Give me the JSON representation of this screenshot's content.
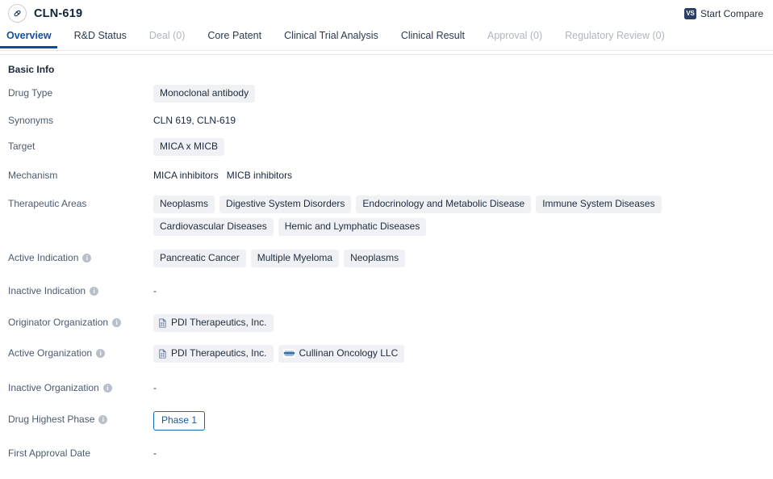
{
  "header": {
    "drug_icon": "pill-capsule-icon",
    "title": "CLN-619",
    "compare_icon_text": "VS",
    "compare_label": "Start Compare"
  },
  "tabs": [
    {
      "label": "Overview",
      "state": "active"
    },
    {
      "label": "R&D Status",
      "state": "normal"
    },
    {
      "label": "Deal (0)",
      "state": "disabled"
    },
    {
      "label": "Core Patent",
      "state": "normal"
    },
    {
      "label": "Clinical Trial Analysis",
      "state": "normal"
    },
    {
      "label": "Clinical Result",
      "state": "normal"
    },
    {
      "label": "Approval (0)",
      "state": "disabled"
    },
    {
      "label": "Regulatory Review (0)",
      "state": "disabled"
    }
  ],
  "section": {
    "title": "Basic Info"
  },
  "rows": {
    "drug_type": {
      "label": "Drug Type",
      "tags": [
        "Monoclonal antibody"
      ]
    },
    "synonyms": {
      "label": "Synonyms",
      "text": "CLN 619,  CLN-619"
    },
    "target": {
      "label": "Target",
      "tags": [
        "MICA x MICB"
      ]
    },
    "mechanism": {
      "label": "Mechanism",
      "items": [
        "MICA inhibitors",
        "MICB inhibitors"
      ]
    },
    "therapeutic_areas": {
      "label": "Therapeutic Areas",
      "tags": [
        "Neoplasms",
        "Digestive System Disorders",
        "Endocrinology and Metabolic Disease",
        "Immune System Diseases",
        "Cardiovascular Diseases",
        "Hemic and Lymphatic Diseases"
      ]
    },
    "active_indication": {
      "label": "Active Indication",
      "has_info": true,
      "tags": [
        "Pancreatic Cancer",
        "Multiple Myeloma",
        "Neoplasms"
      ]
    },
    "inactive_indication": {
      "label": "Inactive Indication",
      "has_info": true,
      "value": "-"
    },
    "originator_organization": {
      "label": "Originator Organization",
      "has_info": true,
      "orgs": [
        {
          "name": "PDI Therapeutics, Inc.",
          "icon": "building-doc-icon"
        }
      ]
    },
    "active_organization": {
      "label": "Active Organization",
      "has_info": true,
      "orgs": [
        {
          "name": "PDI Therapeutics, Inc.",
          "icon": "building-doc-icon"
        },
        {
          "name": "Cullinan Oncology LLC",
          "icon": "company-logo-icon"
        }
      ]
    },
    "inactive_organization": {
      "label": "Inactive Organization",
      "has_info": true,
      "value": "-"
    },
    "drug_highest_phase": {
      "label": "Drug Highest Phase",
      "has_info": true,
      "badge": "Phase 1"
    },
    "first_approval_date": {
      "label": "First Approval Date",
      "has_info": false,
      "value": "-"
    }
  },
  "colors": {
    "accent_blue": "#0d4b9b",
    "tag_bg": "#f0f1f4",
    "label_gray": "#4b5a6e",
    "disabled_tab": "#aeb6c1",
    "vs_badge": "#2c3e63"
  }
}
